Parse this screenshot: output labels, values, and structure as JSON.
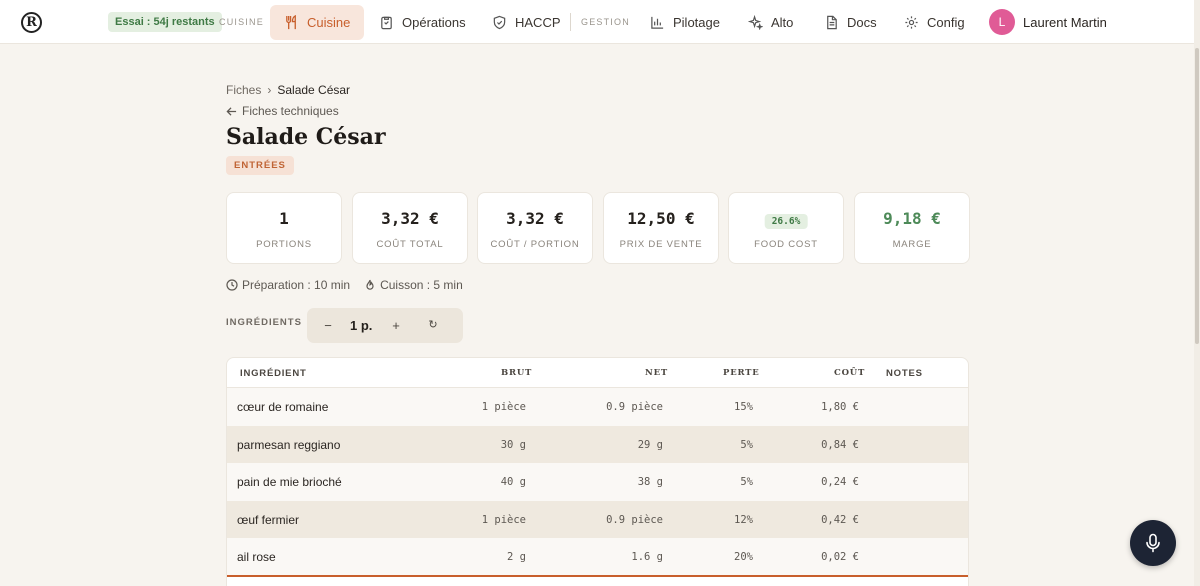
{
  "nav": {
    "logo": "R",
    "trial": "Essai : 54j restants",
    "section_cuisine": "CUISINE",
    "section_gestion": "GESTION",
    "items": [
      {
        "label": "Cuisine",
        "icon": "utensils-icon",
        "active": true
      },
      {
        "label": "Opérations",
        "icon": "clipboard-icon"
      },
      {
        "label": "HACCP",
        "icon": "shield-icon"
      },
      {
        "label": "Pilotage",
        "icon": "bar-chart-icon"
      },
      {
        "label": "Alto",
        "icon": "sparkles-icon"
      },
      {
        "label": "Docs",
        "icon": "document-icon"
      },
      {
        "label": "Config",
        "icon": "gear-icon"
      }
    ],
    "user": {
      "initial": "L",
      "name": "Laurent Martin"
    }
  },
  "breadcrumb": {
    "parent": "Fiches",
    "separator": "›",
    "current": "Salade César"
  },
  "back_link": "Fiches techniques",
  "title": "Salade César",
  "category": "ENTRÉES",
  "stats": [
    {
      "value": "1",
      "label": "PORTIONS"
    },
    {
      "value": "3,32 €",
      "label": "COÛT TOTAL"
    },
    {
      "value": "3,32 €",
      "label": "COÛT / PORTION"
    },
    {
      "value": "12,50 €",
      "label": "PRIX DE VENTE"
    },
    {
      "value": "26.6%",
      "label": "FOOD COST"
    },
    {
      "value": "9,18 €",
      "label": "MARGE"
    }
  ],
  "timing": {
    "preparation": "Préparation : 10 min",
    "cuisson": "Cuisson : 5 min"
  },
  "ingredients": {
    "label": "INGRÉDIENTS",
    "stepper": {
      "minus": "−",
      "qty": "1 p.",
      "plus": "+",
      "reset": "↻"
    },
    "columns": {
      "ingredient": "INGRÉDIENT",
      "brut": "BRUT",
      "net": "NET",
      "perte": "PERTE",
      "cout": "COÛT",
      "notes": "NOTES"
    },
    "rows": [
      {
        "name": "cœur de romaine",
        "brut": "1 pièce",
        "net": "0.9 pièce",
        "perte": "15%",
        "cout": "1,80 €"
      },
      {
        "name": "parmesan reggiano",
        "brut": "30 g",
        "net": "29 g",
        "perte": "5%",
        "cout": "0,84 €"
      },
      {
        "name": "pain de mie brioché",
        "brut": "40 g",
        "net": "38 g",
        "perte": "5%",
        "cout": "0,24 €"
      },
      {
        "name": "œuf fermier",
        "brut": "1 pièce",
        "net": "0.9 pièce",
        "perte": "12%",
        "cout": "0,42 €"
      },
      {
        "name": "ail rose",
        "brut": "2 g",
        "net": "1.6 g",
        "perte": "20%",
        "cout": "0,02 €"
      }
    ]
  },
  "colors": {
    "accent": "#c85f2c",
    "positive": "#4d8a58",
    "background": "#f7f4ef"
  }
}
